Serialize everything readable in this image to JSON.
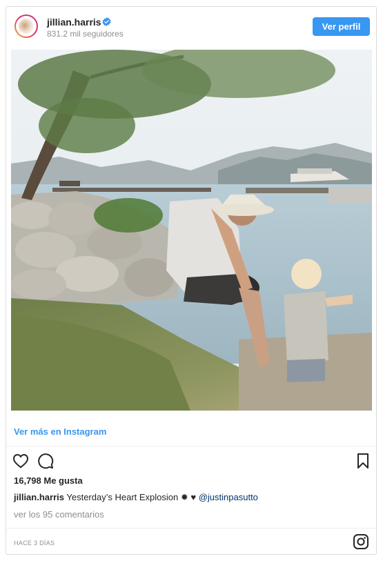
{
  "header": {
    "username": "jillian.harris",
    "followers": "831.2 mil seguidores",
    "view_profile_label": "Ver perfil",
    "verified_icon": "verified-badge-icon",
    "verified_color": "#3897f0"
  },
  "post": {
    "view_more_label": "Ver más en Instagram",
    "likes": "16,798 Me gusta",
    "caption_user": "jillian.harris",
    "caption_text": "Yesterday’s Heart Explosion ✹ ♥",
    "caption_mention": "@justinpasutto",
    "comments_label": "ver los 95 comentarios",
    "timestamp": "HACE 3 DÍAS"
  },
  "icons": {
    "like": "heart-icon",
    "comment": "comment-bubble-icon",
    "save": "bookmark-icon",
    "brand": "instagram-logo-icon"
  },
  "colors": {
    "accent": "#3897f0",
    "text": "#262626",
    "muted": "#8e8e8e",
    "mention": "#003569",
    "border": "#dbdbdb"
  }
}
